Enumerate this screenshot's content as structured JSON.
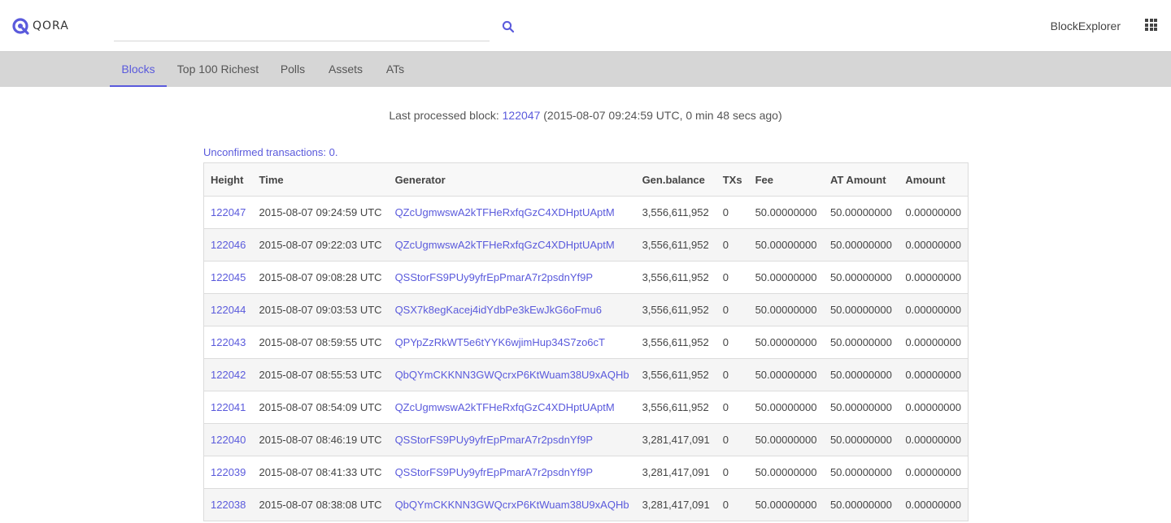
{
  "header": {
    "logo_text": "QORA",
    "search": {
      "value": "",
      "placeholder": ""
    },
    "brand_link": "BlockExplorer",
    "search_icon": "search-icon",
    "apps_icon": "apps-grid-icon"
  },
  "tabs": [
    {
      "label": "Blocks",
      "active": true
    },
    {
      "label": "Top 100 Richest",
      "active": false
    },
    {
      "label": "Polls",
      "active": false
    },
    {
      "label": "Assets",
      "active": false
    },
    {
      "label": "ATs",
      "active": false
    }
  ],
  "status": {
    "prefix": "Last processed block: ",
    "block": "122047",
    "suffix": " (2015-08-07 09:24:59 UTC, 0 min 48 secs ago)"
  },
  "unconfirmed": "Unconfirmed transactions: 0.",
  "table": {
    "columns": [
      "Height",
      "Time",
      "Generator",
      "Gen.balance",
      "TXs",
      "Fee",
      "AT Amount",
      "Amount"
    ],
    "rows": [
      [
        "122047",
        "2015-08-07 09:24:59 UTC",
        "QZcUgmwswA2kTFHeRxfqGzC4XDHptUAptM",
        "3,556,611,952",
        "0",
        "50.00000000",
        "50.00000000",
        "0.00000000"
      ],
      [
        "122046",
        "2015-08-07 09:22:03 UTC",
        "QZcUgmwswA2kTFHeRxfqGzC4XDHptUAptM",
        "3,556,611,952",
        "0",
        "50.00000000",
        "50.00000000",
        "0.00000000"
      ],
      [
        "122045",
        "2015-08-07 09:08:28 UTC",
        "QSStorFS9PUy9yfrEpPmarA7r2psdnYf9P",
        "3,556,611,952",
        "0",
        "50.00000000",
        "50.00000000",
        "0.00000000"
      ],
      [
        "122044",
        "2015-08-07 09:03:53 UTC",
        "QSX7k8egKacej4idYdbPe3kEwJkG6oFmu6",
        "3,556,611,952",
        "0",
        "50.00000000",
        "50.00000000",
        "0.00000000"
      ],
      [
        "122043",
        "2015-08-07 08:59:55 UTC",
        "QPYpZzRkWT5e6tYYK6wjimHup34S7zo6cT",
        "3,556,611,952",
        "0",
        "50.00000000",
        "50.00000000",
        "0.00000000"
      ],
      [
        "122042",
        "2015-08-07 08:55:53 UTC",
        "QbQYmCKKNN3GWQcrxP6KtWuam38U9xAQHb",
        "3,556,611,952",
        "0",
        "50.00000000",
        "50.00000000",
        "0.00000000"
      ],
      [
        "122041",
        "2015-08-07 08:54:09 UTC",
        "QZcUgmwswA2kTFHeRxfqGzC4XDHptUAptM",
        "3,556,611,952",
        "0",
        "50.00000000",
        "50.00000000",
        "0.00000000"
      ],
      [
        "122040",
        "2015-08-07 08:46:19 UTC",
        "QSStorFS9PUy9yfrEpPmarA7r2psdnYf9P",
        "3,281,417,091",
        "0",
        "50.00000000",
        "50.00000000",
        "0.00000000"
      ],
      [
        "122039",
        "2015-08-07 08:41:33 UTC",
        "QSStorFS9PUy9yfrEpPmarA7r2psdnYf9P",
        "3,281,417,091",
        "0",
        "50.00000000",
        "50.00000000",
        "0.00000000"
      ],
      [
        "122038",
        "2015-08-07 08:38:08 UTC",
        "QbQYmCKKNN3GWQcrxP6KtWuam38U9xAQHb",
        "3,281,417,091",
        "0",
        "50.00000000",
        "50.00000000",
        "0.00000000"
      ]
    ]
  },
  "colors": {
    "accent": "#5a5adc",
    "tabbar": "#d6d6d6",
    "text": "#444444"
  }
}
